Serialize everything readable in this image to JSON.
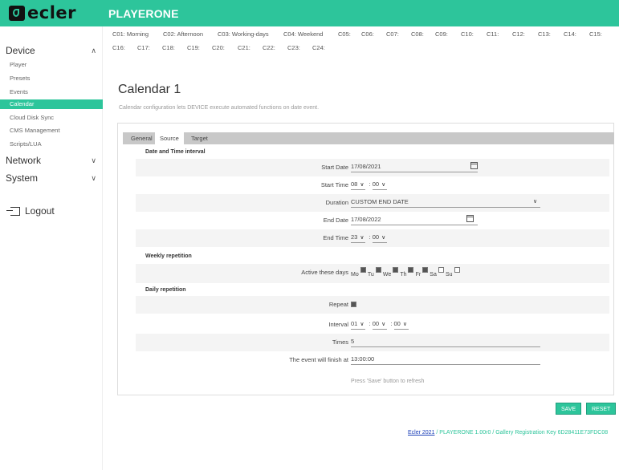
{
  "brand": {
    "logo_text": "ecler",
    "app_title": "PLAYERONE"
  },
  "colors": {
    "accent": "#2dc59b",
    "link": "#1a3eb8"
  },
  "sidebar": {
    "device": "Device",
    "device_items": [
      "Player",
      "Presets",
      "Events",
      "Calendar",
      "Cloud Disk Sync",
      "CMS Management",
      "Scripts/LUA"
    ],
    "active_item": "Calendar",
    "network": "Network",
    "system": "System",
    "logout": "Logout"
  },
  "calendar_tabs": {
    "row1": [
      "C01: Morning",
      "C02: Afternoon",
      "C03: Working-days",
      "C04: Weekend",
      "C05:",
      "C06:",
      "C07:",
      "C08:",
      "C09:",
      "C10:",
      "C11:",
      "C12:",
      "C13:",
      "C14:",
      "C15:"
    ],
    "row2": [
      "C16:",
      "C17:",
      "C18:",
      "C19:",
      "C20:",
      "C21:",
      "C22:",
      "C23:",
      "C24:"
    ]
  },
  "page": {
    "title": "Calendar 1",
    "description": "Calendar configuration lets DEVICE execute automated functions on date event."
  },
  "panel_tabs": [
    "General",
    "Source",
    "Target"
  ],
  "active_panel_tab": "Source",
  "form": {
    "section_datetime": "Date and Time interval",
    "start_date_label": "Start Date",
    "start_date": "17/08/2021",
    "start_time_label": "Start Time",
    "start_hour": "08",
    "start_min": "00",
    "duration_label": "Duration",
    "duration": "CUSTOM END DATE",
    "end_date_label": "End Date",
    "end_date": "17/08/2022",
    "end_time_label": "End Time",
    "end_hour": "23",
    "end_min": "00",
    "section_weekly": "Weekly repetition",
    "active_days_label": "Active these days",
    "days": [
      {
        "label": "Mo",
        "checked": true
      },
      {
        "label": "Tu",
        "checked": true
      },
      {
        "label": "We",
        "checked": true
      },
      {
        "label": "Th",
        "checked": true
      },
      {
        "label": "Fr",
        "checked": true
      },
      {
        "label": "Sa",
        "checked": false
      },
      {
        "label": "Su",
        "checked": false
      }
    ],
    "section_daily": "Daily repetition",
    "repeat_label": "Repeat",
    "repeat_checked": true,
    "interval_label": "Interval",
    "interval_h": "01",
    "interval_m": "00",
    "interval_s": "00",
    "times_label": "Times",
    "times": "5",
    "finish_label": "The event will finish at",
    "finish": "13:00:00",
    "hint": "Press 'Save' button to refresh"
  },
  "buttons": {
    "save": "SAVE",
    "reset": "RESET"
  },
  "footer": {
    "link": "Ecler 2021",
    "text": " / PLAYERONE 1.00r0 / Gallery Registration Key 6D28411E73FDC08"
  }
}
